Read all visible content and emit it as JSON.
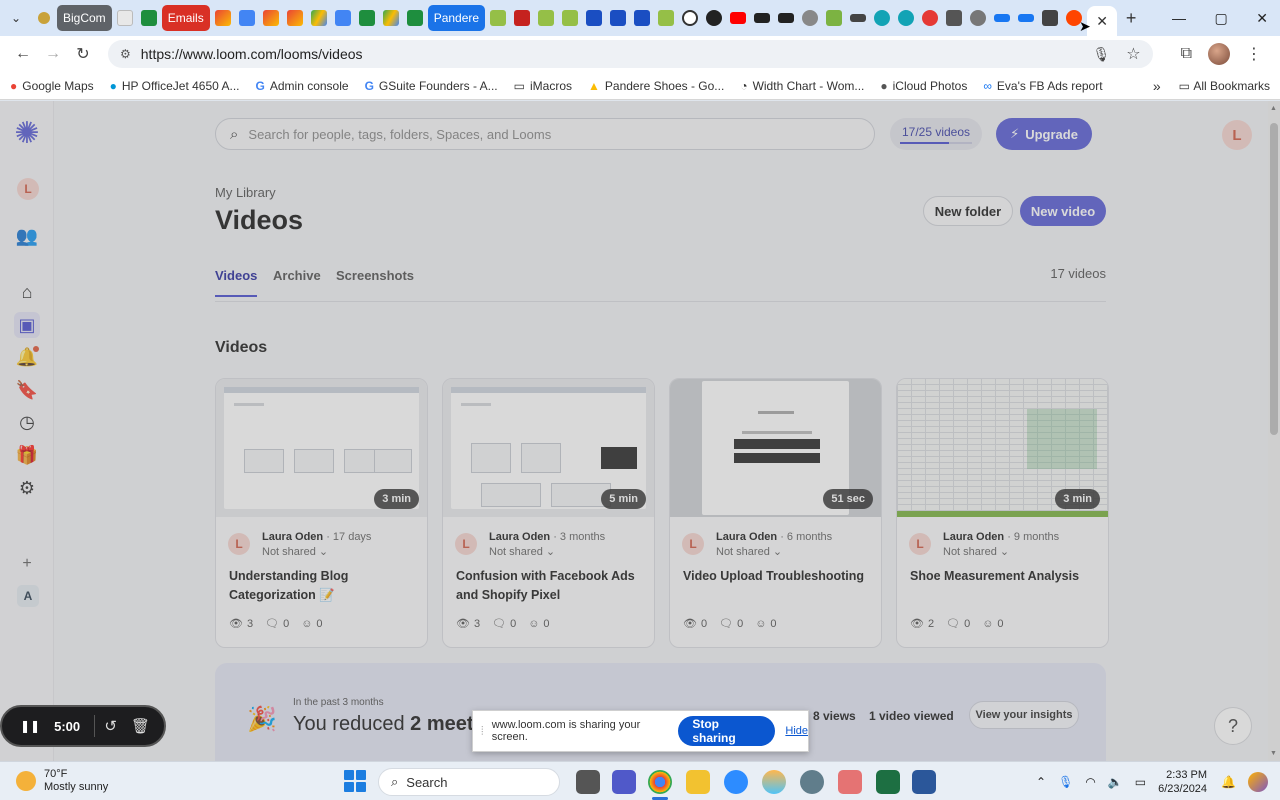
{
  "browser": {
    "tabs": {
      "labels": [
        "BigCom",
        "Emails",
        "Pandere"
      ],
      "active_close": "✕",
      "new_tab": "+"
    },
    "window": {
      "minimize": "—",
      "maximize": "▢",
      "close": "✕"
    },
    "address": "https://www.loom.com/looms/videos",
    "bookmarks": [
      "Google Maps",
      "HP OfficeJet 4650 A...",
      "Admin console",
      "GSuite Founders - A...",
      "iMacros",
      "Pandere Shoes - Go...",
      "Width Chart - Wom...",
      "iCloud Photos",
      "Eva's FB Ads report"
    ],
    "bookmarks_more": "»",
    "all_bookmarks": "All Bookmarks"
  },
  "app": {
    "avatar_letter": "L",
    "workspace_letter": "A",
    "search_placeholder": "Search for people, tags, folders, Spaces, and Looms",
    "quota": {
      "label": "17/25 videos",
      "fraction": 0.68
    },
    "upgrade": "Upgrade",
    "breadcrumb": "My Library",
    "title": "Videos",
    "new_folder": "New folder",
    "new_video": "New video",
    "tabs": [
      "Videos",
      "Archive",
      "Screenshots"
    ],
    "video_count": "17 videos",
    "section_title": "Videos",
    "videos": [
      {
        "duration": "3 min",
        "author": "Laura Oden",
        "ago": "· 17 days",
        "sharing": "Not shared",
        "title": "Understanding Blog Categorization 📝",
        "views": "3",
        "comments": "0",
        "reactions": "0"
      },
      {
        "duration": "5 min",
        "author": "Laura Oden",
        "ago": "· 3 months",
        "sharing": "Not shared",
        "title": "Confusion with Facebook Ads and Shopify Pixel",
        "views": "3",
        "comments": "0",
        "reactions": "0"
      },
      {
        "duration": "51 sec",
        "author": "Laura Oden",
        "ago": "· 6 months",
        "sharing": "Not shared",
        "title": "Video Upload Troubleshooting",
        "views": "0",
        "comments": "0",
        "reactions": "0"
      },
      {
        "duration": "3 min",
        "author": "Laura Oden",
        "ago": "· 9 months",
        "sharing": "Not shared",
        "title": "Shoe Measurement Analysis",
        "views": "2",
        "comments": "0",
        "reactions": "0"
      }
    ],
    "insights": {
      "subtitle": "In the past 3 months",
      "headline_prefix": "You reduced ",
      "headline_bold": "2 meet",
      "views": "8 views",
      "viewed": "1 video viewed",
      "button": "View your insights"
    },
    "help": "?"
  },
  "recorder": {
    "time": "5:00"
  },
  "share_banner": {
    "text": "www.loom.com is sharing your screen.",
    "stop": "Stop sharing",
    "hide": "Hide"
  },
  "taskbar": {
    "temperature": "70°F",
    "condition": "Mostly sunny",
    "search": "Search",
    "time": "2:33 PM",
    "date": "6/23/2024"
  }
}
